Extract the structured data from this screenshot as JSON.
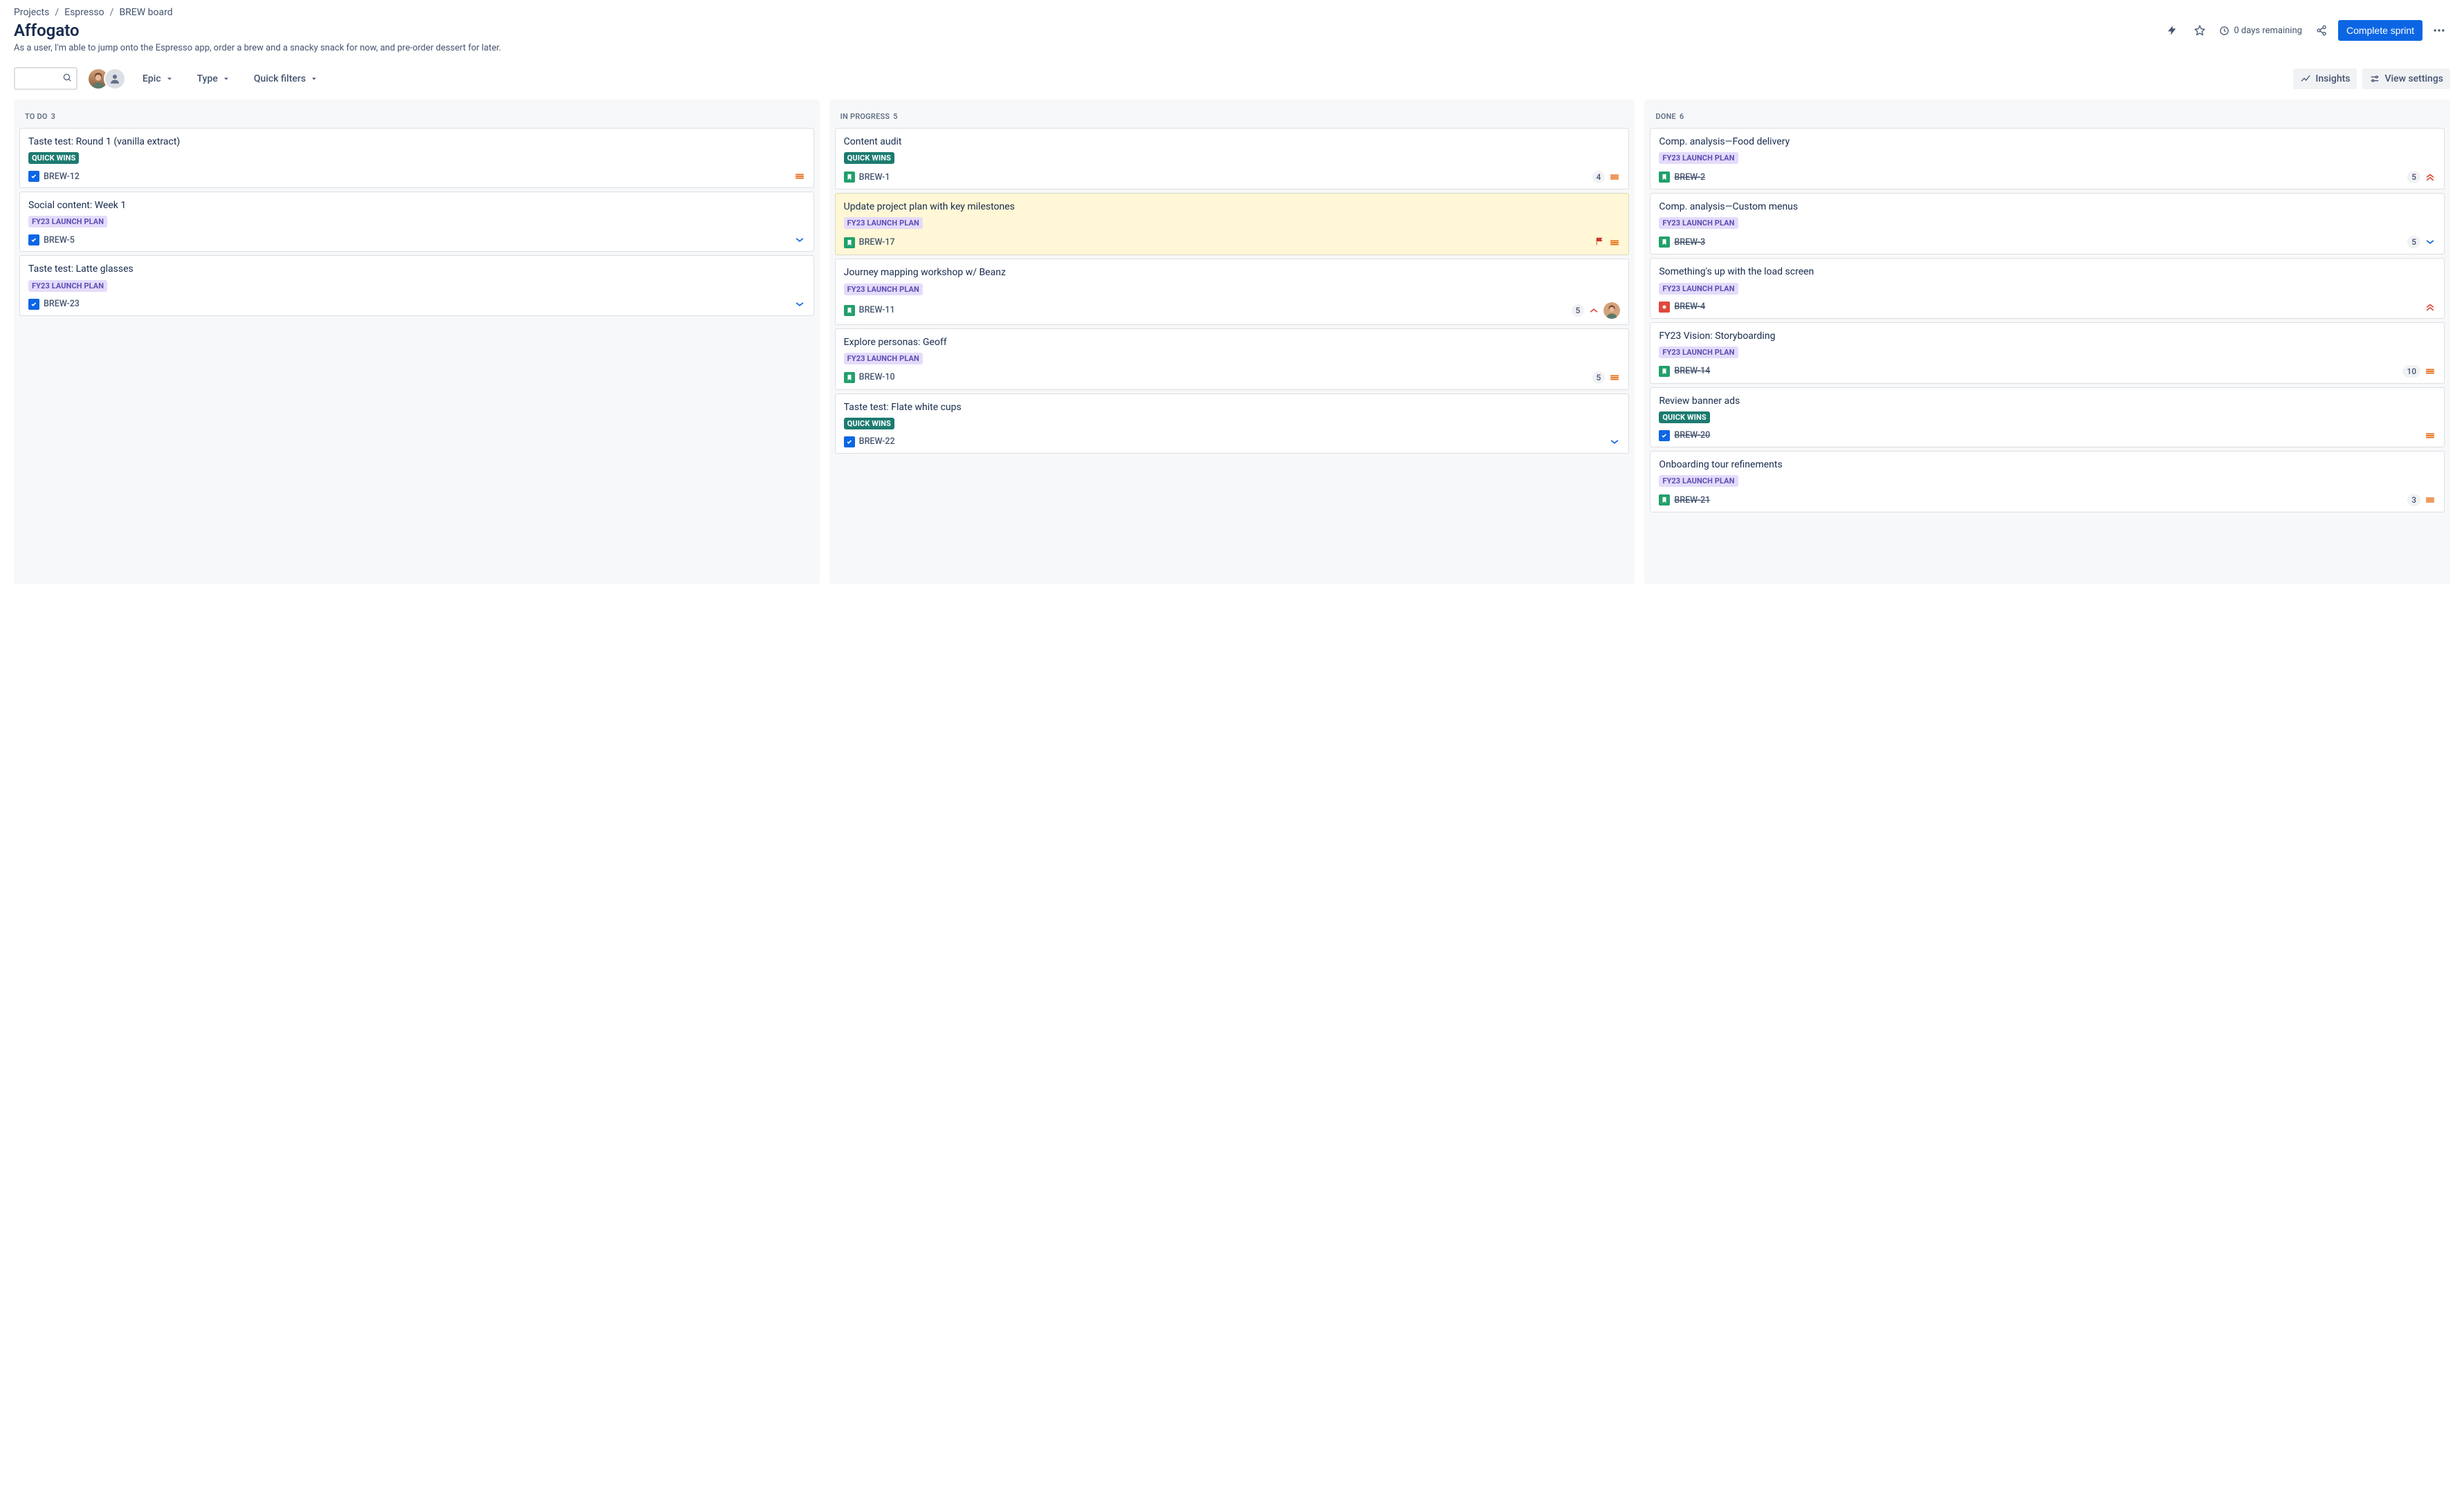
{
  "breadcrumbs": [
    "Projects",
    "Espresso",
    "BREW board"
  ],
  "header": {
    "title": "Affogato",
    "goal": "As a user, I'm able to jump onto the Espresso app, order a brew and a snacky snack for now, and pre-order dessert for later.",
    "time_remaining": "0 days remaining",
    "complete_sprint": "Complete sprint"
  },
  "toolbar": {
    "search_placeholder": "",
    "filters": {
      "epic": "Epic",
      "type": "Type",
      "quick": "Quick filters"
    },
    "insights": "Insights",
    "view_settings": "View settings"
  },
  "labels": {
    "quickwins": "QUICK WINS",
    "launch": "FY23 LAUNCH PLAN"
  },
  "columns": [
    {
      "id": "todo",
      "name": "TO DO",
      "count": 3,
      "cards": [
        {
          "title": "Taste test: Round 1 (vanilla extract)",
          "label": "quickwins",
          "type": "task",
          "key": "BREW-12",
          "priority": "medium"
        },
        {
          "title": "Social content: Week 1",
          "label": "launch",
          "type": "task",
          "key": "BREW-5",
          "priority": "low"
        },
        {
          "title": "Taste test: Latte glasses",
          "label": "launch",
          "type": "task",
          "key": "BREW-23",
          "priority": "low"
        }
      ]
    },
    {
      "id": "inprogress",
      "name": "IN PROGRESS",
      "count": 5,
      "cards": [
        {
          "title": "Content audit",
          "label": "quickwins",
          "type": "story",
          "key": "BREW-1",
          "points": 4,
          "priority": "medium"
        },
        {
          "title": "Update project plan with key milestones",
          "label": "launch",
          "type": "story",
          "key": "BREW-17",
          "flagged": true,
          "priority": "medium"
        },
        {
          "title": "Journey mapping workshop w/ Beanz",
          "label": "launch",
          "type": "story",
          "key": "BREW-11",
          "points": 5,
          "priority": "high",
          "assignee": "avatar1"
        },
        {
          "title": "Explore personas: Geoff",
          "label": "launch",
          "type": "story",
          "key": "BREW-10",
          "points": 5,
          "priority": "medium"
        },
        {
          "title": "Taste test: Flate white cups",
          "label": "quickwins",
          "type": "task",
          "key": "BREW-22",
          "priority": "low"
        }
      ]
    },
    {
      "id": "done",
      "name": "DONE",
      "count": 6,
      "cards": [
        {
          "title": "Comp. analysis—Food delivery",
          "label": "launch",
          "type": "story",
          "key": "BREW-2",
          "points": 5,
          "priority": "highest",
          "done": true
        },
        {
          "title": "Comp. analysis—Custom menus",
          "label": "launch",
          "type": "story",
          "key": "BREW-3",
          "points": 5,
          "priority": "low",
          "done": true
        },
        {
          "title": "Something's up with the load screen",
          "label": "launch",
          "type": "bug",
          "key": "BREW-4",
          "priority": "highest",
          "done": true
        },
        {
          "title": "FY23 Vision: Storyboarding",
          "label": "launch",
          "type": "story",
          "key": "BREW-14",
          "points": 10,
          "priority": "medium",
          "done": true
        },
        {
          "title": "Review banner ads",
          "label": "quickwins",
          "type": "task",
          "key": "BREW-20",
          "priority": "medium",
          "done": true
        },
        {
          "title": "Onboarding tour refinements",
          "label": "launch",
          "type": "story",
          "key": "BREW-21",
          "points": 3,
          "priority": "medium",
          "done": true
        }
      ]
    }
  ]
}
